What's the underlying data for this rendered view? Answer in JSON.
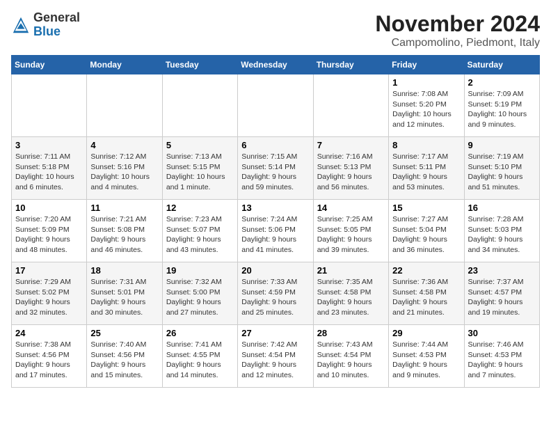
{
  "logo": {
    "general": "General",
    "blue": "Blue"
  },
  "header": {
    "month": "November 2024",
    "location": "Campomolino, Piedmont, Italy"
  },
  "days_of_week": [
    "Sunday",
    "Monday",
    "Tuesday",
    "Wednesday",
    "Thursday",
    "Friday",
    "Saturday"
  ],
  "weeks": [
    [
      {
        "day": "",
        "info": ""
      },
      {
        "day": "",
        "info": ""
      },
      {
        "day": "",
        "info": ""
      },
      {
        "day": "",
        "info": ""
      },
      {
        "day": "",
        "info": ""
      },
      {
        "day": "1",
        "info": "Sunrise: 7:08 AM\nSunset: 5:20 PM\nDaylight: 10 hours\nand 12 minutes."
      },
      {
        "day": "2",
        "info": "Sunrise: 7:09 AM\nSunset: 5:19 PM\nDaylight: 10 hours\nand 9 minutes."
      }
    ],
    [
      {
        "day": "3",
        "info": "Sunrise: 7:11 AM\nSunset: 5:18 PM\nDaylight: 10 hours\nand 6 minutes."
      },
      {
        "day": "4",
        "info": "Sunrise: 7:12 AM\nSunset: 5:16 PM\nDaylight: 10 hours\nand 4 minutes."
      },
      {
        "day": "5",
        "info": "Sunrise: 7:13 AM\nSunset: 5:15 PM\nDaylight: 10 hours\nand 1 minute."
      },
      {
        "day": "6",
        "info": "Sunrise: 7:15 AM\nSunset: 5:14 PM\nDaylight: 9 hours\nand 59 minutes."
      },
      {
        "day": "7",
        "info": "Sunrise: 7:16 AM\nSunset: 5:13 PM\nDaylight: 9 hours\nand 56 minutes."
      },
      {
        "day": "8",
        "info": "Sunrise: 7:17 AM\nSunset: 5:11 PM\nDaylight: 9 hours\nand 53 minutes."
      },
      {
        "day": "9",
        "info": "Sunrise: 7:19 AM\nSunset: 5:10 PM\nDaylight: 9 hours\nand 51 minutes."
      }
    ],
    [
      {
        "day": "10",
        "info": "Sunrise: 7:20 AM\nSunset: 5:09 PM\nDaylight: 9 hours\nand 48 minutes."
      },
      {
        "day": "11",
        "info": "Sunrise: 7:21 AM\nSunset: 5:08 PM\nDaylight: 9 hours\nand 46 minutes."
      },
      {
        "day": "12",
        "info": "Sunrise: 7:23 AM\nSunset: 5:07 PM\nDaylight: 9 hours\nand 43 minutes."
      },
      {
        "day": "13",
        "info": "Sunrise: 7:24 AM\nSunset: 5:06 PM\nDaylight: 9 hours\nand 41 minutes."
      },
      {
        "day": "14",
        "info": "Sunrise: 7:25 AM\nSunset: 5:05 PM\nDaylight: 9 hours\nand 39 minutes."
      },
      {
        "day": "15",
        "info": "Sunrise: 7:27 AM\nSunset: 5:04 PM\nDaylight: 9 hours\nand 36 minutes."
      },
      {
        "day": "16",
        "info": "Sunrise: 7:28 AM\nSunset: 5:03 PM\nDaylight: 9 hours\nand 34 minutes."
      }
    ],
    [
      {
        "day": "17",
        "info": "Sunrise: 7:29 AM\nSunset: 5:02 PM\nDaylight: 9 hours\nand 32 minutes."
      },
      {
        "day": "18",
        "info": "Sunrise: 7:31 AM\nSunset: 5:01 PM\nDaylight: 9 hours\nand 30 minutes."
      },
      {
        "day": "19",
        "info": "Sunrise: 7:32 AM\nSunset: 5:00 PM\nDaylight: 9 hours\nand 27 minutes."
      },
      {
        "day": "20",
        "info": "Sunrise: 7:33 AM\nSunset: 4:59 PM\nDaylight: 9 hours\nand 25 minutes."
      },
      {
        "day": "21",
        "info": "Sunrise: 7:35 AM\nSunset: 4:58 PM\nDaylight: 9 hours\nand 23 minutes."
      },
      {
        "day": "22",
        "info": "Sunrise: 7:36 AM\nSunset: 4:58 PM\nDaylight: 9 hours\nand 21 minutes."
      },
      {
        "day": "23",
        "info": "Sunrise: 7:37 AM\nSunset: 4:57 PM\nDaylight: 9 hours\nand 19 minutes."
      }
    ],
    [
      {
        "day": "24",
        "info": "Sunrise: 7:38 AM\nSunset: 4:56 PM\nDaylight: 9 hours\nand 17 minutes."
      },
      {
        "day": "25",
        "info": "Sunrise: 7:40 AM\nSunset: 4:56 PM\nDaylight: 9 hours\nand 15 minutes."
      },
      {
        "day": "26",
        "info": "Sunrise: 7:41 AM\nSunset: 4:55 PM\nDaylight: 9 hours\nand 14 minutes."
      },
      {
        "day": "27",
        "info": "Sunrise: 7:42 AM\nSunset: 4:54 PM\nDaylight: 9 hours\nand 12 minutes."
      },
      {
        "day": "28",
        "info": "Sunrise: 7:43 AM\nSunset: 4:54 PM\nDaylight: 9 hours\nand 10 minutes."
      },
      {
        "day": "29",
        "info": "Sunrise: 7:44 AM\nSunset: 4:53 PM\nDaylight: 9 hours\nand 9 minutes."
      },
      {
        "day": "30",
        "info": "Sunrise: 7:46 AM\nSunset: 4:53 PM\nDaylight: 9 hours\nand 7 minutes."
      }
    ]
  ]
}
